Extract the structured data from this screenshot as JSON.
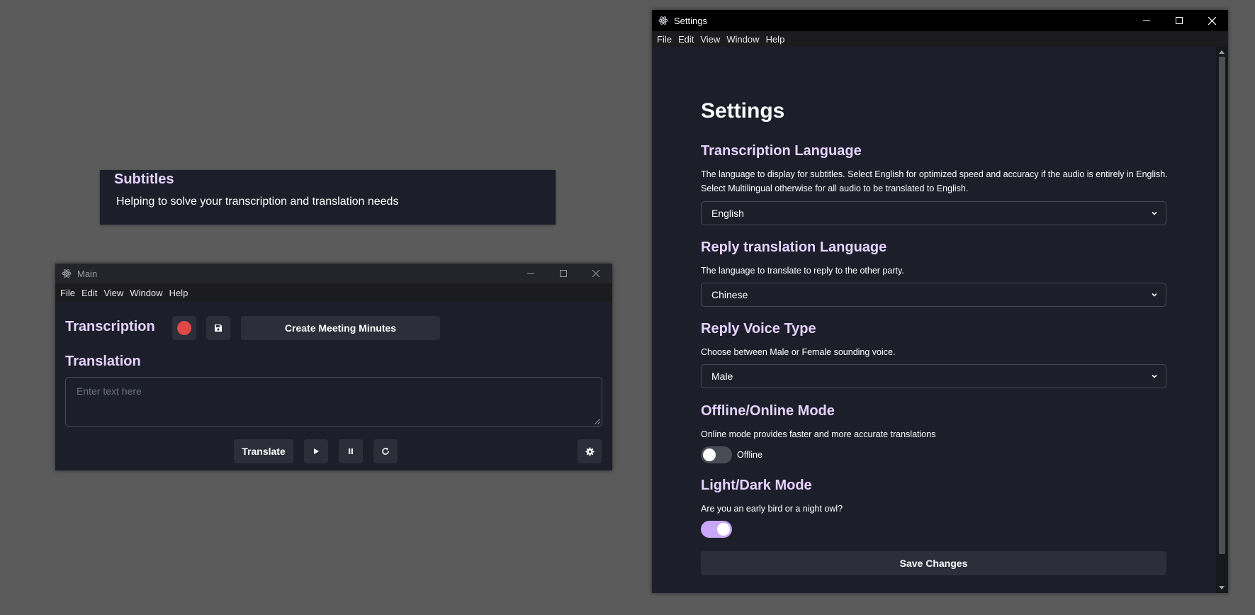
{
  "subtitles": {
    "title": "Subtitles",
    "description": "Helping to solve your transcription and translation needs"
  },
  "main_window": {
    "title": "Main",
    "menu": [
      "File",
      "Edit",
      "View",
      "Window",
      "Help"
    ],
    "transcription_heading": "Transcription",
    "record_button_color": "#e04848",
    "meeting_minutes_label": "Create Meeting Minutes",
    "translation_heading": "Translation",
    "input_placeholder": "Enter text here",
    "translate_label": "Translate",
    "icons": [
      "save-icon",
      "play-icon",
      "pause-icon",
      "refresh-icon",
      "gear-icon"
    ]
  },
  "settings_window": {
    "title": "Settings",
    "menu": [
      "File",
      "Edit",
      "View",
      "Window",
      "Help"
    ],
    "page_title": "Settings",
    "transcription_language": {
      "heading": "Transcription Language",
      "description_line1": "The language to display for subtitles. Select English for optimized speed and accuracy if the audio is entirely in English.",
      "description_line2": "Select Multilingual otherwise for all audio to be translated to English.",
      "value": "English"
    },
    "reply_language": {
      "heading": "Reply translation Language",
      "description": "The language to translate to reply to the other party.",
      "value": "Chinese"
    },
    "voice_type": {
      "heading": "Reply Voice Type",
      "description": "Choose between Male or Female sounding voice.",
      "value": "Male"
    },
    "online_mode": {
      "heading": "Offline/Online Mode",
      "description": "Online mode provides faster and more accurate translations",
      "state_label": "Offline",
      "enabled": false
    },
    "dark_mode": {
      "heading": "Light/Dark Mode",
      "description": "Are you an early bird or a night owl?",
      "enabled": true
    },
    "save_label": "Save Changes"
  },
  "colors": {
    "desktop": "#5b5b5b",
    "panel": "#1c1f2a",
    "accent_heading": "#e6d2ff",
    "toggle_on": "#c9a6f7",
    "toggle_off": "#4a4c55"
  }
}
